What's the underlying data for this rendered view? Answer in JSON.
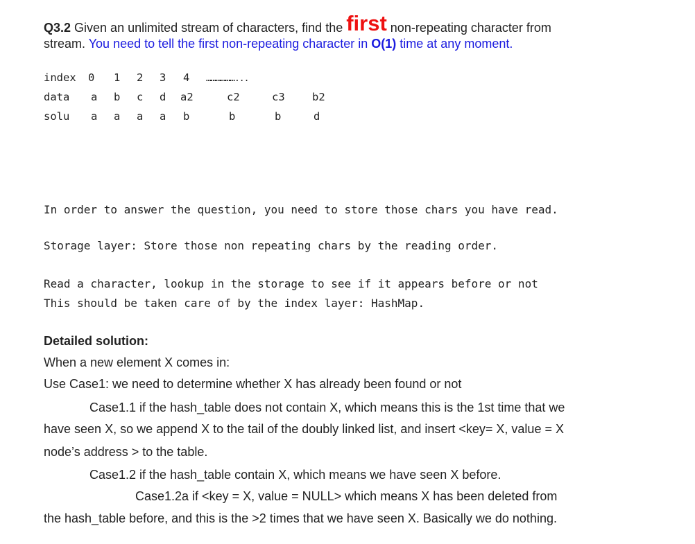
{
  "question": {
    "label": "Q3.2",
    "text_before": " Given an unlimited stream of characters, find the ",
    "emphasis": "first",
    "text_after": " non-repeating character from",
    "line2_plain": "stream. ",
    "line2_blue_a": "You need to tell the first non-repeating character in ",
    "line2_blue_bold": "O(1)",
    "line2_blue_b": " time at any moment."
  },
  "table": {
    "index_label": "index",
    "data_label": "data",
    "solu_label": "solu",
    "index": [
      "0",
      "1",
      "2",
      "3",
      "4"
    ],
    "index_trail": "………………...",
    "data": [
      "a",
      "b",
      "c",
      "d",
      "a2",
      "c2",
      "c3",
      "b2"
    ],
    "solu": [
      "a",
      "a",
      "a",
      "a",
      "b",
      "b",
      "b",
      "d"
    ]
  },
  "notes": {
    "line1": "In order to answer the question, you need to store those chars you have read.",
    "line2": "Storage layer: Store those non repeating chars by the reading order.",
    "line3": "Read a character, lookup in the storage to see if it appears before or not",
    "line4": "This should be taken care of by the index layer: HashMap."
  },
  "solution": {
    "heading": "Detailed solution:",
    "p1": "When a new element X comes in:",
    "p2": "Use Case1:  we need to determine whether X has already been found or not",
    "c11_l1": "Case1.1 if the hash_table does not contain X, which means this is the 1st time that we",
    "c11_l2": "have seen X, so  we append X to the tail of the doubly linked list, and  insert <key= X, value = X",
    "c11_l3": "node’s address > to the table.",
    "c12": "Case1.2 if the hash_table contain X,    which means we have seen X before.",
    "c12a_l1": "Case1.2a  if <key = X,   value = NULL> which means X has been deleted from",
    "c12a_l2": "the hash_table before, and this is the >2 times that we have seen X.   Basically we do nothing."
  }
}
